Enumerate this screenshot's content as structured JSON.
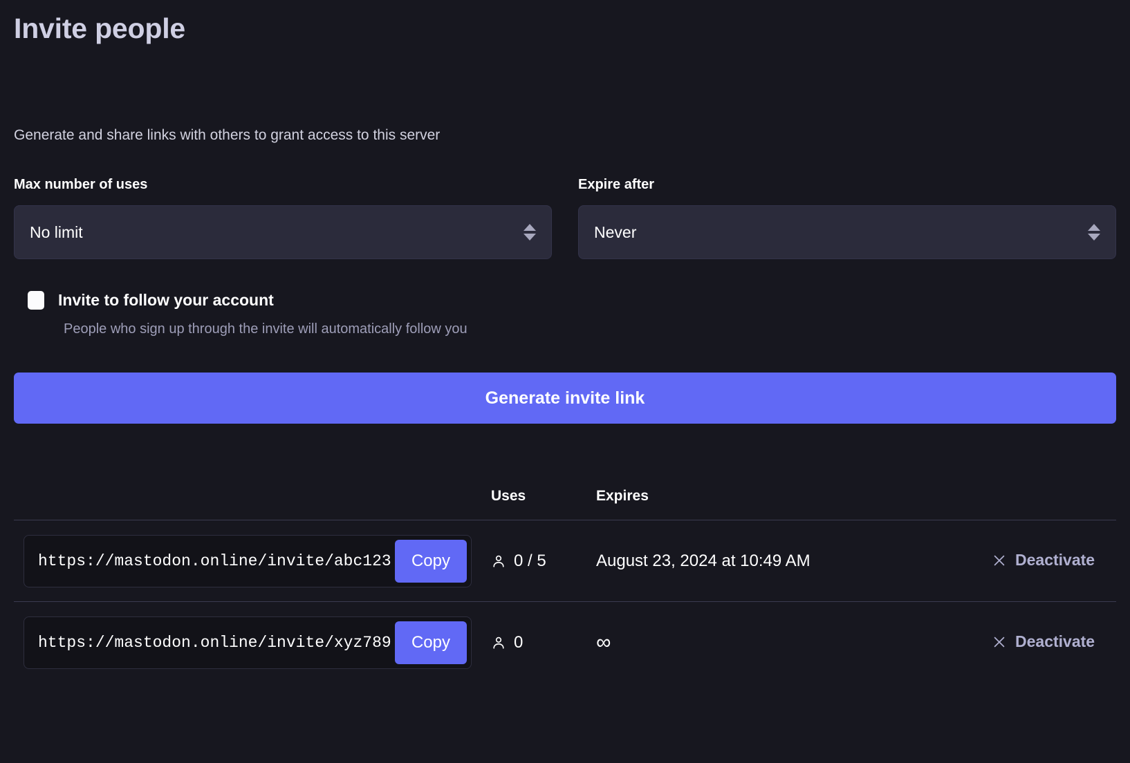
{
  "page": {
    "title": "Invite people",
    "lead": "Generate and share links with others to grant access to this server"
  },
  "form": {
    "max_uses": {
      "label": "Max number of uses",
      "value": "No limit"
    },
    "expire_after": {
      "label": "Expire after",
      "value": "Never"
    },
    "follow_checkbox": {
      "label": "Invite to follow your account",
      "hint": "People who sign up through the invite will automatically follow you",
      "checked": false
    },
    "generate_button": "Generate invite link"
  },
  "table": {
    "headers": {
      "link": "",
      "uses": "Uses",
      "expires": "Expires",
      "action": ""
    },
    "rows": [
      {
        "link": "https://mastodon.online/invite/abc123",
        "copy_label": "Copy",
        "uses": "0 / 5",
        "expires": "August 23, 2024 at 10:49 AM",
        "deactivate_label": "Deactivate"
      },
      {
        "link": "https://mastodon.online/invite/xyz789",
        "copy_label": "Copy",
        "uses": "0",
        "expires": "∞",
        "deactivate_label": "Deactivate"
      }
    ]
  },
  "colors": {
    "page_background": "#17171f",
    "accent": "#6169f5",
    "select_background": "#2b2b3b",
    "input_background": "#121218",
    "muted_text": "#9e9eb8",
    "link_text": "#b0b0d0",
    "divider": "#3b3b50"
  }
}
